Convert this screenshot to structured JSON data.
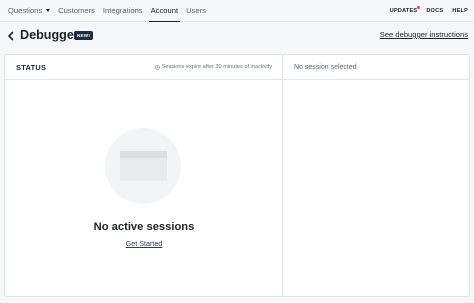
{
  "nav": {
    "items": [
      {
        "label": "Questions",
        "dropdown": true
      },
      {
        "label": "Customers"
      },
      {
        "label": "Integrations"
      },
      {
        "label": "Account",
        "active": true
      },
      {
        "label": "Users"
      }
    ],
    "right": {
      "updates": "UPDATES",
      "docs": "DOCS",
      "help": "HELP",
      "updates_dot_color": "#e0454b"
    }
  },
  "header": {
    "title": "Debugger",
    "badge": "NEW!",
    "instructions_link": "See debugger instructions",
    "back_icon": "chevron-left-icon"
  },
  "status_panel": {
    "label": "STATUS",
    "expire_note": "Sessions expire after 30 minutes of inactivity",
    "clock_icon": "clock-icon",
    "empty_title": "No active sessions",
    "get_started": "Get Started"
  },
  "session_panel": {
    "placeholder": "No session selected"
  }
}
